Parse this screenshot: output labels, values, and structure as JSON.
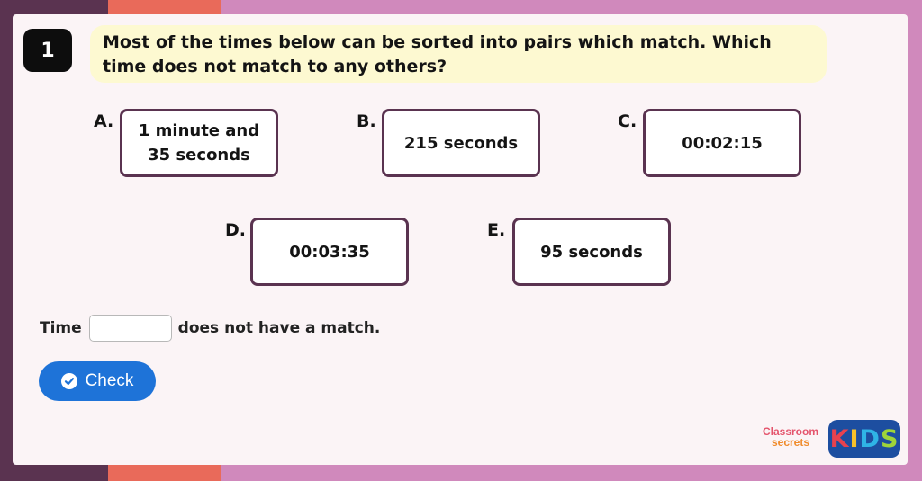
{
  "question": {
    "number": "1",
    "text": "Most of the times below can be sorted into pairs which match. Which time does not match to any others?"
  },
  "options": [
    {
      "letter": "A.",
      "text": "1 minute and 35 seconds"
    },
    {
      "letter": "B.",
      "text": "215 seconds"
    },
    {
      "letter": "C.",
      "text": "00:02:15"
    },
    {
      "letter": "D.",
      "text": "00:03:35"
    },
    {
      "letter": "E.",
      "text": "95 seconds"
    }
  ],
  "answer": {
    "prefix": "Time",
    "value": "",
    "suffix": "does not have a match."
  },
  "check_button": {
    "label": "Check",
    "icon": "check-circle-icon"
  },
  "branding": {
    "classroom_line1": "Classroom",
    "classroom_line2": "secrets",
    "kids_letters": [
      "K",
      "I",
      "D",
      "S"
    ],
    "kids_colors": [
      "#e8424f",
      "#f7c12b",
      "#2fb4e6",
      "#9ed43a"
    ]
  },
  "colors": {
    "accent": "#1e73d8",
    "question_bg": "#fdf9d1",
    "box_border": "#5a3350",
    "page_bg": "#d089bc",
    "left_band": "#5a3350",
    "orange_band": "#e96a5a"
  }
}
